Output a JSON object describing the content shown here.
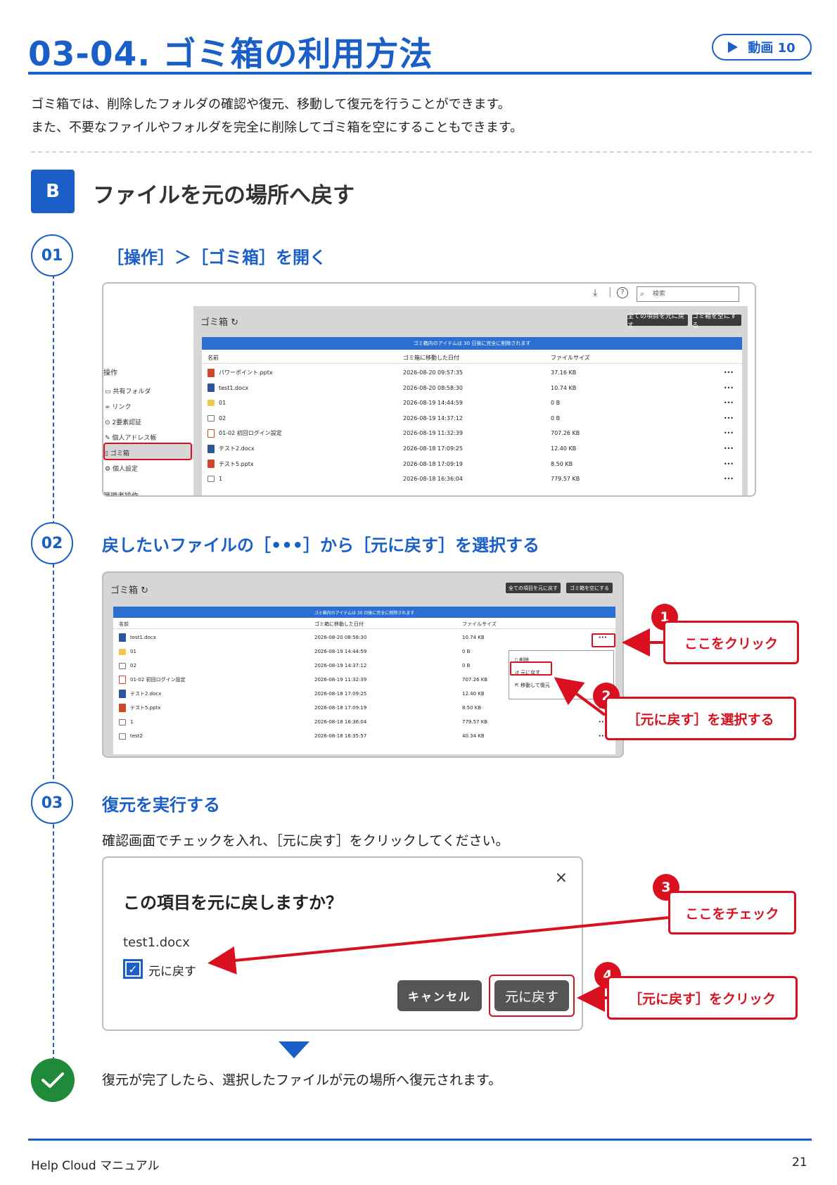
{
  "page": {
    "title": "03-04. ゴミ箱の利用方法",
    "video_badge": "動画 10",
    "intro_lines": [
      "ゴミ箱では、削除したフォルダの確認や復元、移動して復元を行うことができます。",
      "また、不要なファイルやフォルダを完全に削除してゴミ箱を空にすることもできます。"
    ],
    "section_badge": "B",
    "section_title": "ファイルを元の場所へ戻す"
  },
  "steps": [
    {
      "number": "01",
      "title": "［操作］＞［ゴミ箱］を開く"
    },
    {
      "number": "02",
      "title": "戻したいファイルの［•••］から［元に戻す］を選択する"
    },
    {
      "number": "03",
      "title": "復元を実行する",
      "description": "確認画面でチェックを入れ、［元に戻す］をクリックしてください。"
    }
  ],
  "screenshot1": {
    "search_placeholder": "検索",
    "panel_title": "ゴミ箱",
    "restore_all_btn": "全ての項目を元に戻す",
    "empty_trash_btn": "ゴミ箱を空にする",
    "notice": "ゴミ箱内のアイテムは 30 日後に完全に削除されます",
    "columns": [
      "名前",
      "ゴミ箱に移動した日付",
      "ファイルサイズ"
    ],
    "sidebar": {
      "heading": "操作",
      "items": [
        "共有フォルダ",
        "リンク",
        "2要素認証",
        "個人アドレス帳",
        "ゴミ箱",
        "個人設定"
      ],
      "admin_heading": "管理者操作"
    },
    "rows": [
      {
        "name": "パワーポイント.pptx",
        "date": "2026-08-20 09:57:35",
        "size": "37.16 KB",
        "icon": "ppt"
      },
      {
        "name": "test1.docx",
        "date": "2026-08-20 08:58:30",
        "size": "10.74 KB",
        "icon": "word"
      },
      {
        "name": "01",
        "date": "2026-08-19 14:44:59",
        "size": "0 B",
        "icon": "folder"
      },
      {
        "name": "02",
        "date": "2026-08-19 14:37:12",
        "size": "0 B",
        "icon": "shared-folder"
      },
      {
        "name": "01-02 初回ログイン設定",
        "date": "2026-08-19 11:32:39",
        "size": "707.26 KB",
        "icon": "pdf"
      },
      {
        "name": "テスト2.docx",
        "date": "2026-08-18 17:09:25",
        "size": "12.40 KB",
        "icon": "word"
      },
      {
        "name": "テスト5.pptx",
        "date": "2026-08-18 17:09:19",
        "size": "8.50 KB",
        "icon": "ppt"
      },
      {
        "name": "1",
        "date": "2026-08-18 16:36:04",
        "size": "779.57 KB",
        "icon": "shared-folder"
      }
    ],
    "more": "•••"
  },
  "screenshot2": {
    "panel_title": "ゴミ箱",
    "restore_all_btn": "全ての項目を元に戻す",
    "empty_trash_btn": "ゴミ箱を空にする",
    "notice": "ゴミ箱内のアイテムは 30 日後に完全に削除されます",
    "columns": [
      "名前",
      "ゴミ箱に移動した日付",
      "ファイルサイズ"
    ],
    "rows": [
      {
        "name": "test1.docx",
        "date": "2026-08-20 08:58:30",
        "size": "10.74 KB",
        "icon": "word"
      },
      {
        "name": "01",
        "date": "2026-08-19 14:44:59",
        "size": "0 B",
        "icon": "folder"
      },
      {
        "name": "02",
        "date": "2026-08-19 14:37:12",
        "size": "0 B",
        "icon": "shared-folder"
      },
      {
        "name": "01-02 初回ログイン設定",
        "date": "2026-08-19 11:32:39",
        "size": "707.26 KB",
        "icon": "pdf"
      },
      {
        "name": "テスト2.docx",
        "date": "2026-08-18 17:09:25",
        "size": "12.40 KB",
        "icon": "word"
      },
      {
        "name": "テスト5.pptx",
        "date": "2026-08-18 17:09:19",
        "size": "8.50 KB",
        "icon": "ppt"
      },
      {
        "name": "1",
        "date": "2026-08-18 16:36:04",
        "size": "779.57 KB",
        "icon": "shared-folder"
      },
      {
        "name": "test2",
        "date": "2026-08-18 16:35:57",
        "size": "40.34 KB",
        "icon": "shared-folder"
      }
    ],
    "more": "•••",
    "menu": [
      "削除",
      "元に戻す",
      "移動して復元"
    ]
  },
  "callouts": [
    {
      "number": "1",
      "text": "ここをクリック"
    },
    {
      "number": "2",
      "text": "［元に戻す］を選択する"
    },
    {
      "number": "3",
      "text": "ここをチェック"
    },
    {
      "number": "4",
      "text": "［元に戻す］をクリック"
    }
  ],
  "dialog": {
    "close": "×",
    "title": "この項目を元に戻しますか？",
    "file": "test1.docx",
    "checkbox_label": "元に戻す",
    "cancel": "キャンセル",
    "confirm": "元に戻す"
  },
  "result_text": "復元が完了したら、選択したファイルが元の場所へ復元されます。",
  "footer": {
    "left": "Help Cloud マニュアル",
    "page_number": "21"
  },
  "colors": {
    "primary": "#1a5fc7",
    "accent_red": "#d9101f",
    "success": "#1f8a3a"
  }
}
